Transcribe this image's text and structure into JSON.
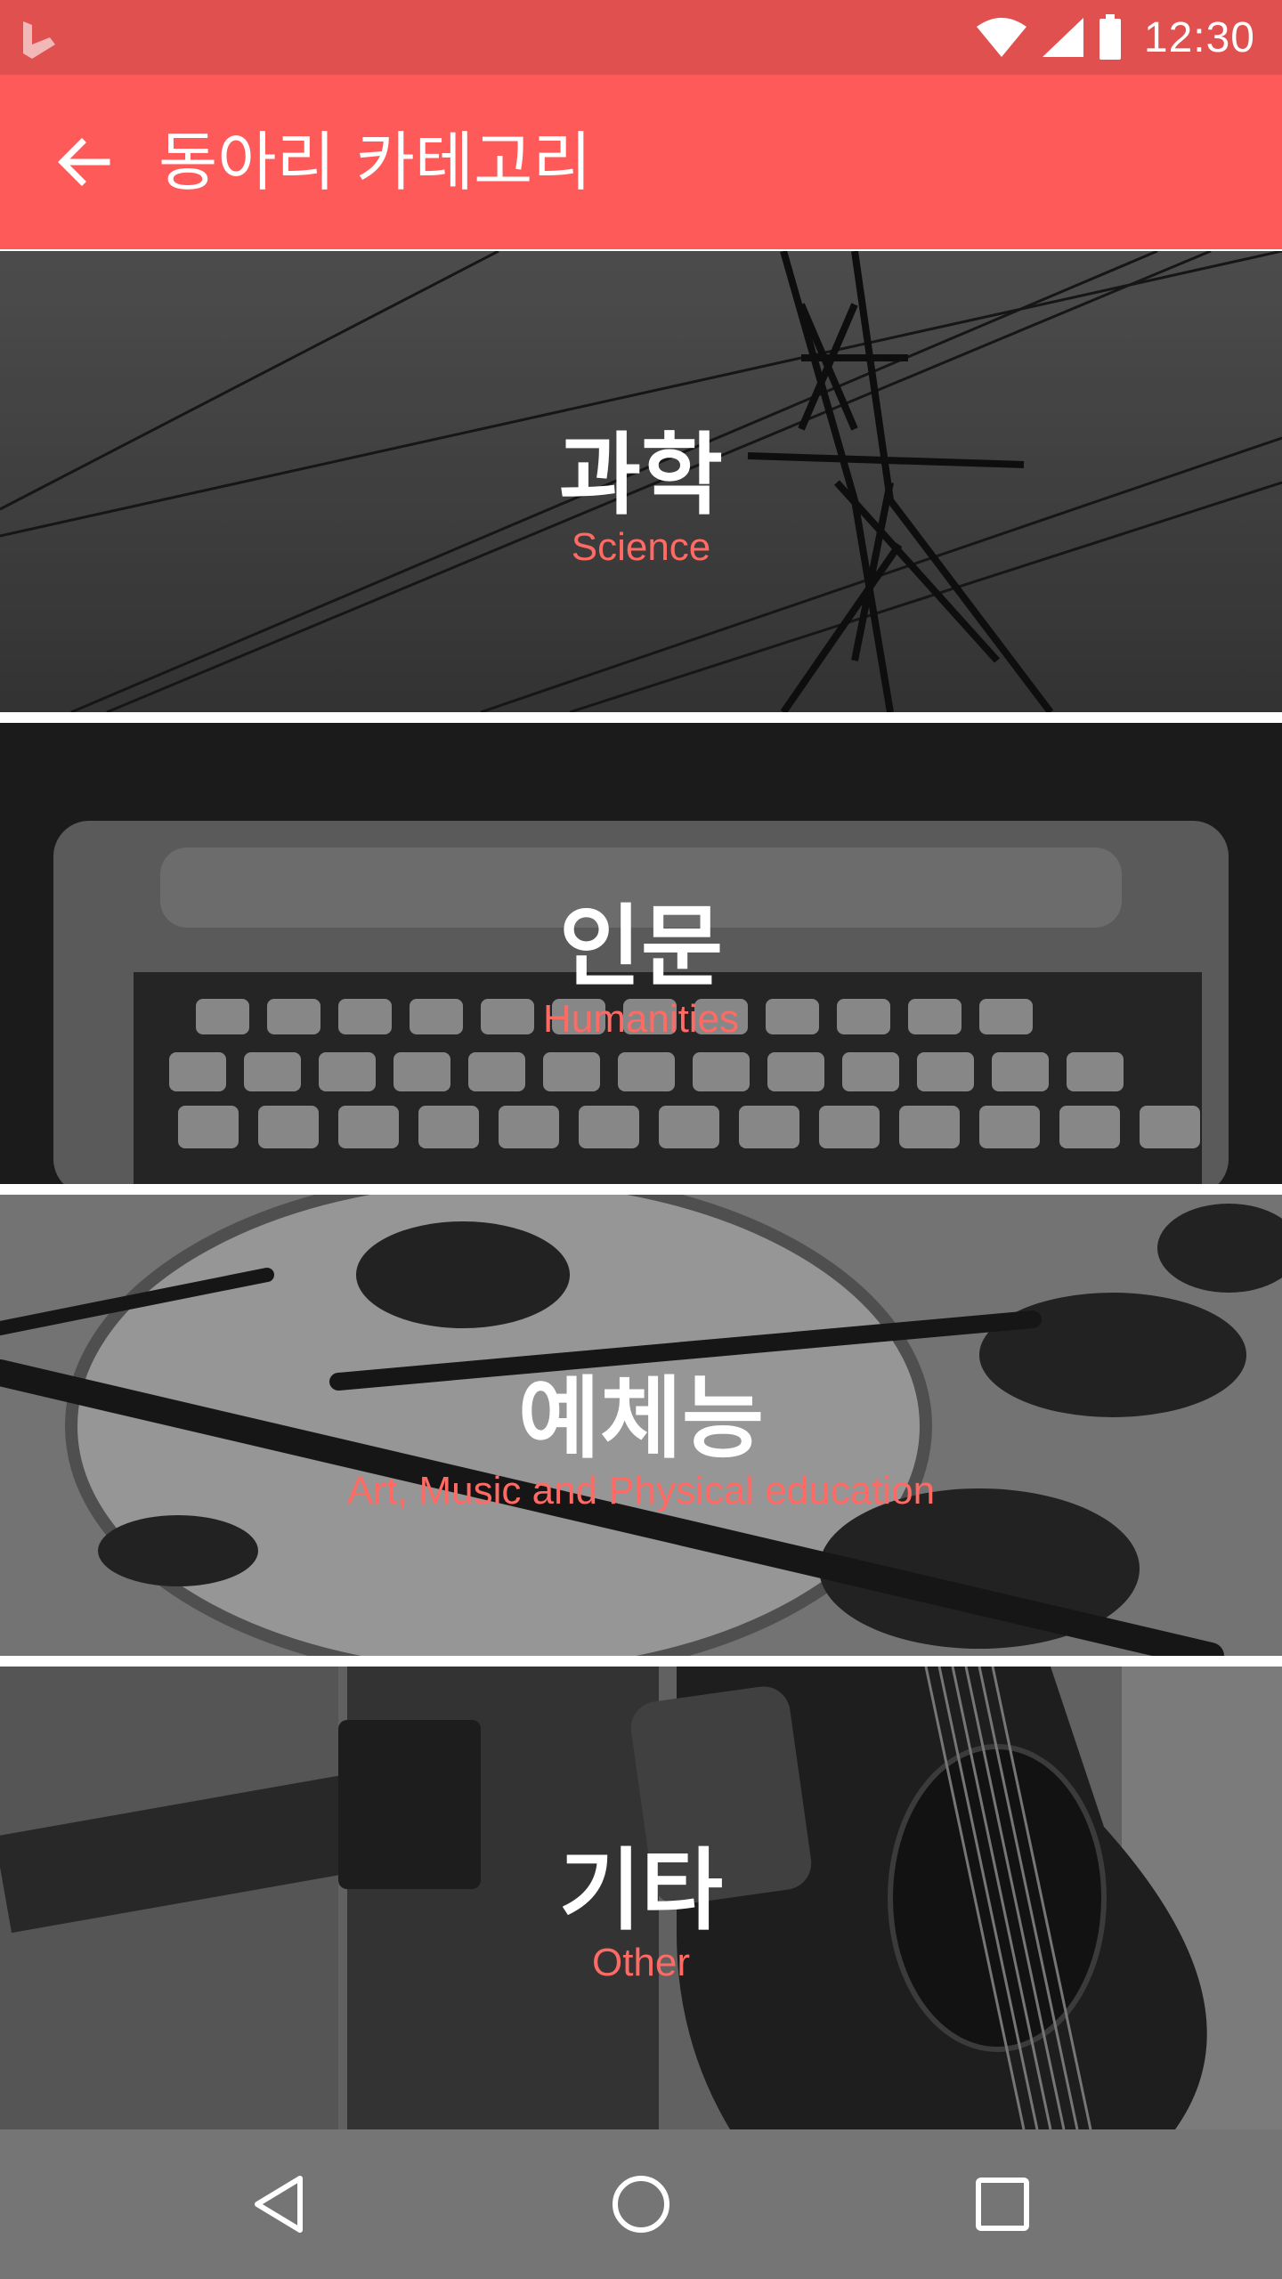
{
  "status_bar": {
    "time": "12:30",
    "icons": [
      "app-logo-icon",
      "wifi-icon",
      "cellular-signal-icon",
      "battery-icon"
    ]
  },
  "app_bar": {
    "title": "동아리 카테고리",
    "back_icon": "arrow-back-icon"
  },
  "categories": [
    {
      "title": "과학",
      "subtitle": "Science"
    },
    {
      "title": "인문",
      "subtitle": "Humanities"
    },
    {
      "title": "예체능",
      "subtitle": "Art, Music and Physical education"
    },
    {
      "title": "기타",
      "subtitle": "Other"
    }
  ],
  "nav_bar": {
    "icons": [
      "back-triangle-icon",
      "home-circle-icon",
      "recents-square-icon"
    ]
  },
  "colors": {
    "status_bar": "#e0504f",
    "app_bar": "#ff5a5a",
    "subtitle": "#ff6a64",
    "nav_bar": "#757575"
  }
}
